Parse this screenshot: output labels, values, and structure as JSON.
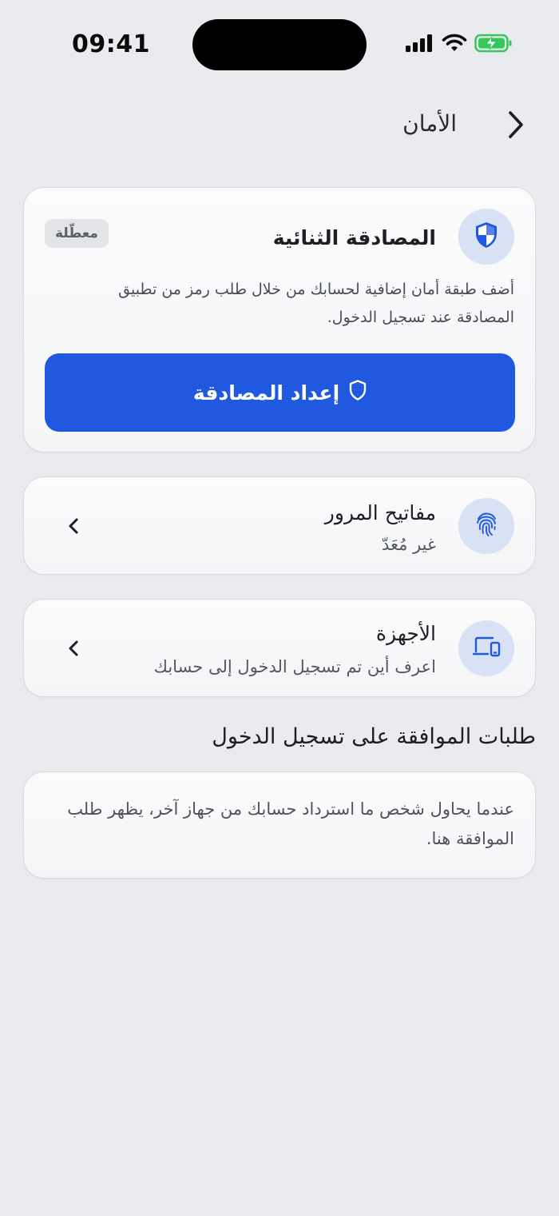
{
  "status_bar": {
    "time": "09:41",
    "icons": [
      "signal-icon",
      "wifi-icon",
      "battery-charging-icon"
    ],
    "battery_color": "#34c759"
  },
  "header": {
    "title": "الأمان",
    "back_icon": "chevron-right-icon"
  },
  "two_factor": {
    "title": "المصادقة الثنائية",
    "badge": "معطّلة",
    "description": "أضف طبقة أمان إضافية لحسابك من خلال طلب رمز من تطبيق المصادقة عند تسجيل الدخول.",
    "button_label": "إعداد المصادقة",
    "icon": "shield-icon",
    "button_icon": "shield-outline-icon"
  },
  "passkeys": {
    "title": "مفاتيح المرور",
    "subtitle": "غير مُعَدّ",
    "icon": "fingerprint-icon"
  },
  "devices": {
    "title": "الأجهزة",
    "subtitle": "اعرف أين تم تسجيل الدخول إلى حسابك",
    "icon": "devices-icon"
  },
  "login_requests": {
    "section_title": "طلبات الموافقة على تسجيل الدخول",
    "empty_text": "عندما يحاول شخص ما استرداد حسابك من جهاز آخر، يظهر طلب الموافقة هنا."
  },
  "colors": {
    "accent": "#2059df",
    "background": "#e9ebef",
    "icon_bg": "#d9e2f4"
  }
}
